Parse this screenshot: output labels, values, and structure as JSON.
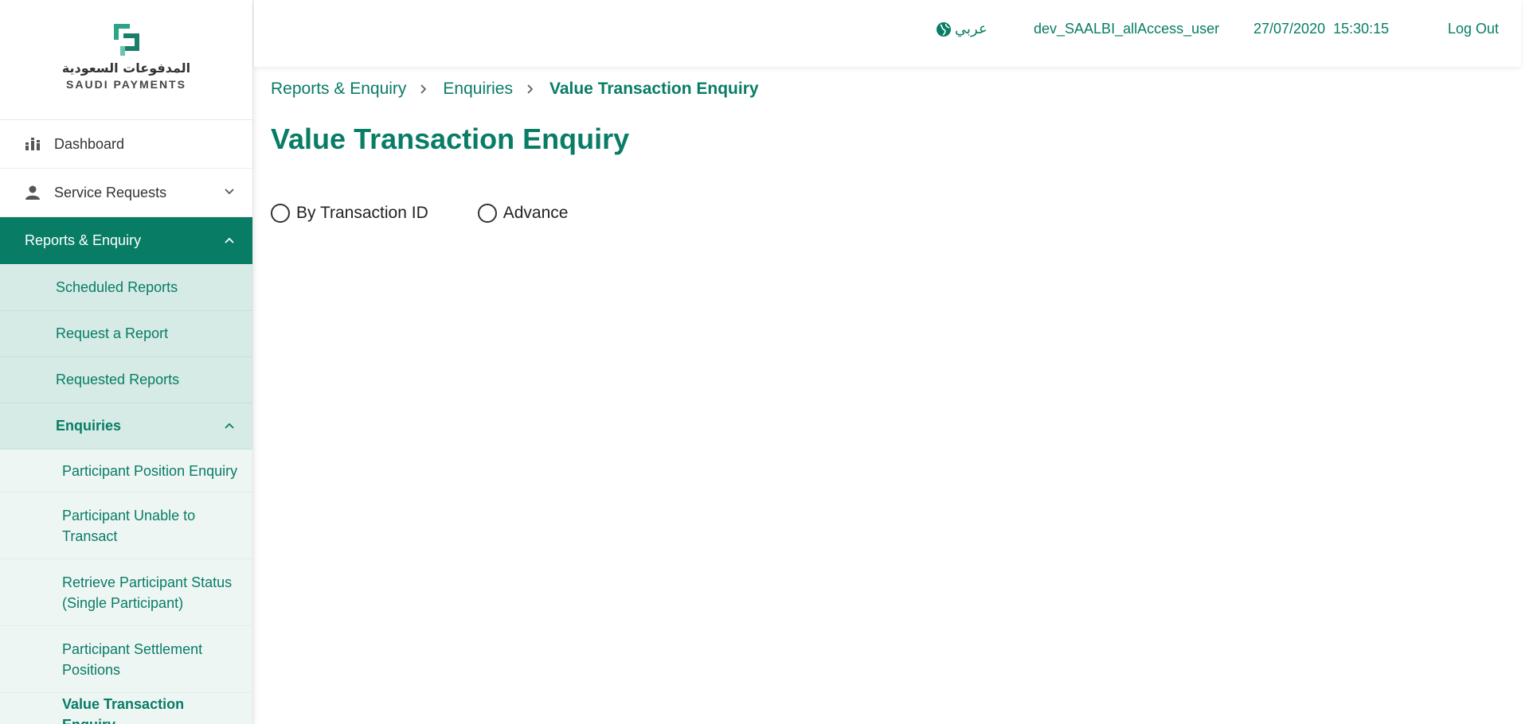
{
  "brand": {
    "logo_arabic": "المدفوعات السعودية",
    "logo_english": "SAUDI PAYMENTS",
    "accent_color": "#087c65"
  },
  "header": {
    "language_label": "عربي",
    "username": "dev_SAALBI_allAccess_user",
    "datetime": "27/07/2020  15:30:15",
    "logout_label": "Log Out"
  },
  "sidebar": {
    "items": [
      {
        "label": "Dashboard",
        "icon": "dashboard-icon"
      },
      {
        "label": "Service Requests",
        "icon": "user-icon"
      },
      {
        "label": "Reports & Enquiry",
        "active": true
      }
    ],
    "reports_sub": [
      {
        "label": "Scheduled Reports"
      },
      {
        "label": "Request a Report"
      },
      {
        "label": "Requested Reports"
      },
      {
        "label": "Enquiries",
        "open": true
      }
    ],
    "enquiries_sub": [
      {
        "label": "Participant Position Enquiry"
      },
      {
        "label": "Participant Unable to Transact"
      },
      {
        "label": "Retrieve Participant Status (Single Participant)"
      },
      {
        "label": "Participant Settlement Positions"
      },
      {
        "label": "Value Transaction Enquiry",
        "current": true
      }
    ]
  },
  "breadcrumb": {
    "items": [
      "Reports & Enquiry",
      "Enquiries",
      "Value Transaction Enquiry"
    ]
  },
  "main": {
    "title": "Value Transaction Enquiry",
    "radio_options": [
      {
        "label": "By Transaction ID",
        "selected": false
      },
      {
        "label": "Advance",
        "selected": false
      }
    ]
  }
}
